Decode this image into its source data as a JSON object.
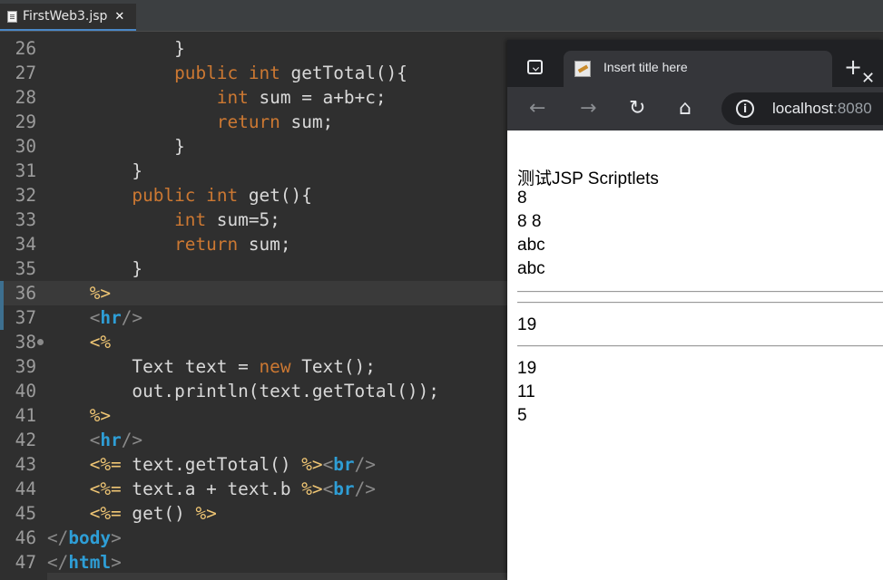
{
  "editor": {
    "tab": {
      "label": "FirstWeb3.jsp",
      "close": "✕"
    },
    "line0": "",
    "lines": [
      {
        "n": "26",
        "segs": [
          {
            "t": "            ",
            "c": "txt"
          },
          {
            "t": "}",
            "c": "txt"
          }
        ]
      },
      {
        "n": "27",
        "segs": [
          {
            "t": "            ",
            "c": "txt"
          },
          {
            "t": "public",
            "c": "kw"
          },
          {
            "t": " ",
            "c": "txt"
          },
          {
            "t": "int",
            "c": "kw"
          },
          {
            "t": " getTotal(){",
            "c": "txt"
          }
        ]
      },
      {
        "n": "28",
        "segs": [
          {
            "t": "                ",
            "c": "txt"
          },
          {
            "t": "int",
            "c": "kw"
          },
          {
            "t": " sum = a+b+c;",
            "c": "txt"
          }
        ]
      },
      {
        "n": "29",
        "segs": [
          {
            "t": "                ",
            "c": "txt"
          },
          {
            "t": "return",
            "c": "kw"
          },
          {
            "t": " sum;",
            "c": "txt"
          }
        ]
      },
      {
        "n": "30",
        "segs": [
          {
            "t": "            }",
            "c": "txt"
          }
        ]
      },
      {
        "n": "31",
        "segs": [
          {
            "t": "        }",
            "c": "txt"
          }
        ]
      },
      {
        "n": "32",
        "segs": [
          {
            "t": "        ",
            "c": "txt"
          },
          {
            "t": "public",
            "c": "kw"
          },
          {
            "t": " ",
            "c": "txt"
          },
          {
            "t": "int",
            "c": "kw"
          },
          {
            "t": " get(){",
            "c": "txt"
          }
        ]
      },
      {
        "n": "33",
        "segs": [
          {
            "t": "            ",
            "c": "txt"
          },
          {
            "t": "int",
            "c": "kw"
          },
          {
            "t": " sum=5;",
            "c": "txt"
          }
        ]
      },
      {
        "n": "34",
        "segs": [
          {
            "t": "            ",
            "c": "txt"
          },
          {
            "t": "return",
            "c": "kw"
          },
          {
            "t": " sum;",
            "c": "txt"
          }
        ]
      },
      {
        "n": "35",
        "segs": [
          {
            "t": "        }",
            "c": "txt"
          }
        ]
      },
      {
        "n": "36",
        "segs": [
          {
            "t": "    ",
            "c": "txt"
          },
          {
            "t": "%>",
            "c": "dl"
          }
        ]
      },
      {
        "n": "37",
        "segs": [
          {
            "t": "    ",
            "c": "txt"
          },
          {
            "t": "<",
            "c": "br"
          },
          {
            "t": "hr",
            "c": "tg"
          },
          {
            "t": "/>",
            "c": "br"
          }
        ]
      },
      {
        "n": "38",
        "segs": [
          {
            "t": "    ",
            "c": "txt"
          },
          {
            "t": "<%",
            "c": "dl"
          }
        ]
      },
      {
        "n": "39",
        "segs": [
          {
            "t": "        Text text = ",
            "c": "txt"
          },
          {
            "t": "new",
            "c": "kw"
          },
          {
            "t": " Text();",
            "c": "txt"
          }
        ]
      },
      {
        "n": "40",
        "segs": [
          {
            "t": "        out.println(text.getTotal());",
            "c": "txt"
          }
        ]
      },
      {
        "n": "41",
        "segs": [
          {
            "t": "    ",
            "c": "txt"
          },
          {
            "t": "%>",
            "c": "dl"
          }
        ]
      },
      {
        "n": "42",
        "segs": [
          {
            "t": "    ",
            "c": "txt"
          },
          {
            "t": "<",
            "c": "br"
          },
          {
            "t": "hr",
            "c": "tg"
          },
          {
            "t": "/>",
            "c": "br"
          }
        ]
      },
      {
        "n": "43",
        "segs": [
          {
            "t": "    ",
            "c": "txt"
          },
          {
            "t": "<%=",
            "c": "dl"
          },
          {
            "t": " text.getTotal() ",
            "c": "txt"
          },
          {
            "t": "%>",
            "c": "dl"
          },
          {
            "t": "<",
            "c": "br"
          },
          {
            "t": "br",
            "c": "tg"
          },
          {
            "t": "/>",
            "c": "br"
          }
        ]
      },
      {
        "n": "44",
        "segs": [
          {
            "t": "    ",
            "c": "txt"
          },
          {
            "t": "<%=",
            "c": "dl"
          },
          {
            "t": " text.a + text.b ",
            "c": "txt"
          },
          {
            "t": "%>",
            "c": "dl"
          },
          {
            "t": "<",
            "c": "br"
          },
          {
            "t": "br",
            "c": "tg"
          },
          {
            "t": "/>",
            "c": "br"
          }
        ]
      },
      {
        "n": "45",
        "segs": [
          {
            "t": "    ",
            "c": "txt"
          },
          {
            "t": "<%=",
            "c": "dl"
          },
          {
            "t": " get() ",
            "c": "txt"
          },
          {
            "t": "%>",
            "c": "dl"
          }
        ]
      },
      {
        "n": "46",
        "segs": [
          {
            "t": "</",
            "c": "br"
          },
          {
            "t": "body",
            "c": "tg"
          },
          {
            "t": ">",
            "c": "br"
          }
        ]
      },
      {
        "n": "47",
        "segs": [
          {
            "t": "</",
            "c": "br"
          },
          {
            "t": "html",
            "c": "tg"
          },
          {
            "t": ">",
            "c": "br"
          }
        ]
      }
    ],
    "current_line": "36",
    "fold_line": "38"
  },
  "browser": {
    "tab_title": "Insert title here",
    "tab_close": "✕",
    "new_tab": "+",
    "nav": {
      "back": "←",
      "forward": "→",
      "reload": "↻",
      "home": "⌂"
    },
    "address": {
      "host": "localhost",
      "port": ":8080"
    },
    "page": {
      "heading": "测试JSP Scriptlets",
      "block1": [
        "8",
        "8 8",
        "abc",
        "abc"
      ],
      "block2": [
        "19"
      ],
      "block3": [
        "19",
        "11",
        "5"
      ]
    }
  },
  "colors": {
    "keyword": "#cc7832",
    "tag": "#2e9ed6",
    "delimiter": "#f0c674",
    "text": "#d9d9d9"
  }
}
